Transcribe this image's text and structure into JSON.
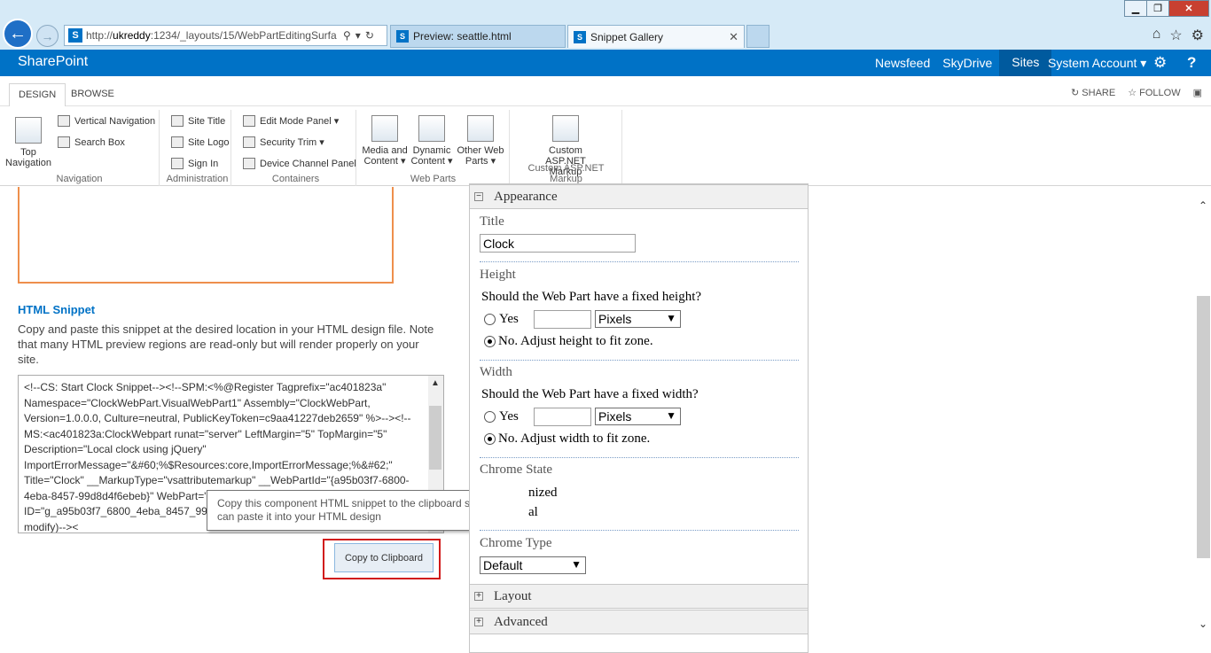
{
  "window": {
    "minimize_glyph": "▁",
    "restore_glyph": "❐",
    "close_glyph": "✕"
  },
  "browser": {
    "url_prefix": "http://",
    "url_host": "ukreddy",
    "url_rest": ":1234/_layouts/15/WebPartEditingSurfa",
    "tabs": [
      {
        "label": "Preview: seattle.html"
      },
      {
        "label": "Snippet Gallery",
        "close": "✕"
      }
    ]
  },
  "suite": {
    "brand": "SharePoint",
    "links": [
      "Newsfeed",
      "SkyDrive",
      "Sites"
    ],
    "account": "System Account ▾",
    "help": "?"
  },
  "ribbon_tabs": {
    "design": "DESIGN",
    "browse": "BROWSE",
    "share": "SHARE",
    "follow": "FOLLOW"
  },
  "ribbon": {
    "navigation": {
      "label": "Navigation",
      "top_navigation": "Top Navigation",
      "vertical_navigation": "Vertical Navigation",
      "search_box": "Search Box"
    },
    "administration": {
      "label": "Administration",
      "site_title": "Site Title",
      "site_logo": "Site Logo",
      "sign_in": "Sign In"
    },
    "containers": {
      "label": "Containers",
      "edit_mode_panel": "Edit Mode Panel ▾",
      "security_trim": "Security Trim ▾",
      "device_channel_panel": "Device Channel Panel"
    },
    "web_parts": {
      "label": "Web Parts",
      "media_and_content": "Media and Content ▾",
      "dynamic_content": "Dynamic Content ▾",
      "other_web_parts": "Other Web Parts ▾"
    },
    "custom_markup": {
      "label": "Custom ASP.NET Markup",
      "button": "Custom ASP.NET Markup"
    }
  },
  "snippet": {
    "heading": "HTML Snippet",
    "description": "Copy and paste this snippet at the desired location in your HTML design file. Note that many HTML preview regions are read-only but will render properly on your site.",
    "code": "<!--CS: Start Clock Snippet--><!--SPM:<%@Register Tagprefix=\"ac401823a\" Namespace=\"ClockWebPart.VisualWebPart1\" Assembly=\"ClockWebPart, Version=1.0.0.0, Culture=neutral, PublicKeyToken=c9aa41227deb2659\" %>--><!--MS:<ac401823a:ClockWebpart runat=\"server\" LeftMargin=\"5\" TopMargin=\"5\" Description=\"Local clock using jQuery\" ImportErrorMessage=\"&#60;%$Resources:core,ImportErrorMessage;%&#62;\" Title=\"Clock\" __MarkupType=\"vsattributemarkup\" __WebPartId=\"{a95b03f7-6800-4eba-8457-99d8d4f6ebeb}\" WebPart=\"true\" __designer:IsClosed=\"false\" ID=\"g_a95b03f7_6800_4eba_8457_99d8d4f6ebeb\"> ... ONLY PREVIEW (do not modify)--><",
    "tooltip": "Copy this component HTML snippet to the clipboard so that you can paste it into your HTML design",
    "copy_button": "Copy to Clipboard"
  },
  "toolpane": {
    "appearance": "Appearance",
    "title_label": "Title",
    "title_value": "Clock",
    "height_label": "Height",
    "height_question": "Should the Web Part have a fixed height?",
    "height_yes": "Yes",
    "height_unit": "Pixels",
    "height_no": "No. Adjust height to fit zone.",
    "width_label": "Width",
    "width_question": "Should the Web Part have a fixed width?",
    "width_yes": "Yes",
    "width_unit": "Pixels",
    "width_no": "No. Adjust width to fit zone.",
    "chrome_state_label": "Chrome State",
    "chrome_state_minimized": "nized",
    "chrome_state_normal": "al",
    "chrome_type_label": "Chrome Type",
    "chrome_type_value": "Default",
    "layout": "Layout",
    "advanced": "Advanced"
  }
}
